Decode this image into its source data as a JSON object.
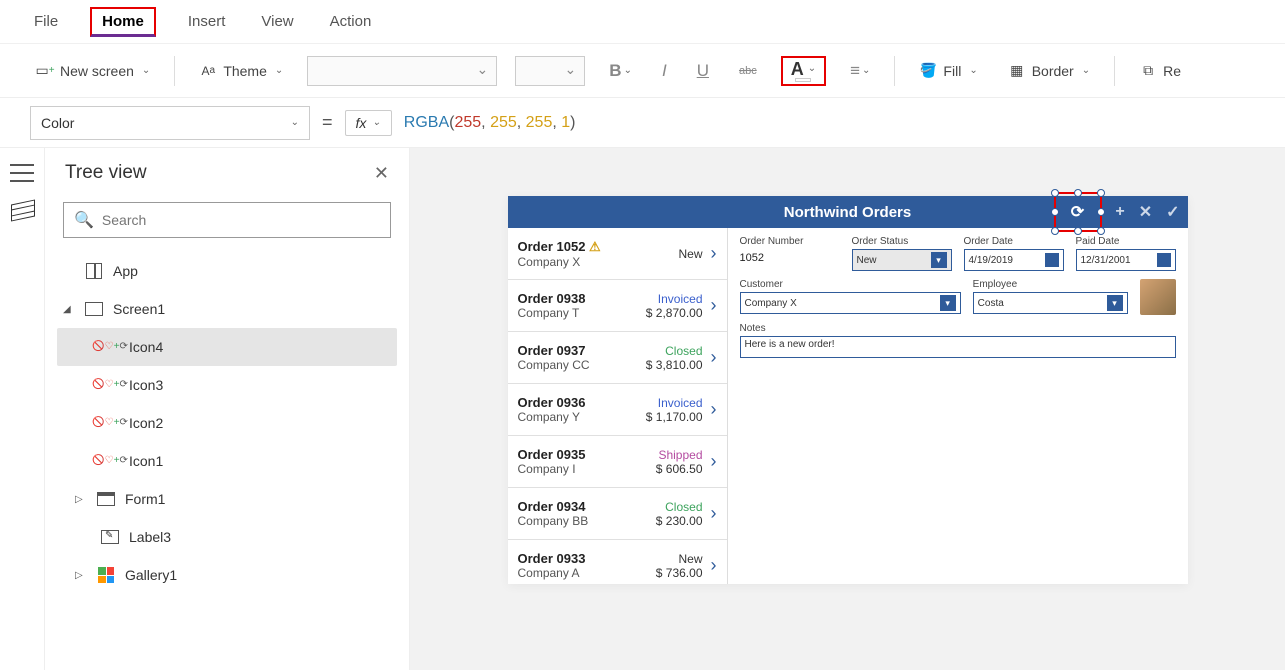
{
  "menu": {
    "file": "File",
    "home": "Home",
    "insert": "Insert",
    "view": "View",
    "action": "Action"
  },
  "ribbon": {
    "new_screen": "New screen",
    "theme": "Theme",
    "fill": "Fill",
    "border": "Border",
    "reorder": "Re"
  },
  "formula": {
    "property": "Color",
    "fn": "RGBA",
    "args": [
      "255",
      "255",
      "255",
      "1"
    ]
  },
  "tree": {
    "title": "Tree view",
    "search_placeholder": "Search",
    "app": "App",
    "screen": "Screen1",
    "icon4": "Icon4",
    "icon3": "Icon3",
    "icon2": "Icon2",
    "icon1": "Icon1",
    "form1": "Form1",
    "label3": "Label3",
    "gallery1": "Gallery1"
  },
  "app": {
    "title": "Northwind Orders",
    "orders": [
      {
        "num": "Order 1052",
        "company": "Company X",
        "status": "New",
        "status_cls": "new",
        "amount": "",
        "warn": true
      },
      {
        "num": "Order 0938",
        "company": "Company T",
        "status": "Invoiced",
        "status_cls": "invoiced",
        "amount": "$ 2,870.00"
      },
      {
        "num": "Order 0937",
        "company": "Company CC",
        "status": "Closed",
        "status_cls": "closed",
        "amount": "$ 3,810.00"
      },
      {
        "num": "Order 0936",
        "company": "Company Y",
        "status": "Invoiced",
        "status_cls": "invoiced",
        "amount": "$ 1,170.00"
      },
      {
        "num": "Order 0935",
        "company": "Company I",
        "status": "Shipped",
        "status_cls": "shipped",
        "amount": "$ 606.50"
      },
      {
        "num": "Order 0934",
        "company": "Company BB",
        "status": "Closed",
        "status_cls": "closed",
        "amount": "$ 230.00"
      },
      {
        "num": "Order 0933",
        "company": "Company A",
        "status": "New",
        "status_cls": "new",
        "amount": "$ 736.00"
      }
    ],
    "detail": {
      "order_number_label": "Order Number",
      "order_number": "1052",
      "order_status_label": "Order Status",
      "order_status": "New",
      "order_date_label": "Order Date",
      "order_date": "4/19/2019",
      "paid_date_label": "Paid Date",
      "paid_date": "12/31/2001",
      "customer_label": "Customer",
      "customer": "Company X",
      "employee_label": "Employee",
      "employee": "Costa",
      "notes_label": "Notes",
      "notes": "Here is a new order!"
    }
  }
}
